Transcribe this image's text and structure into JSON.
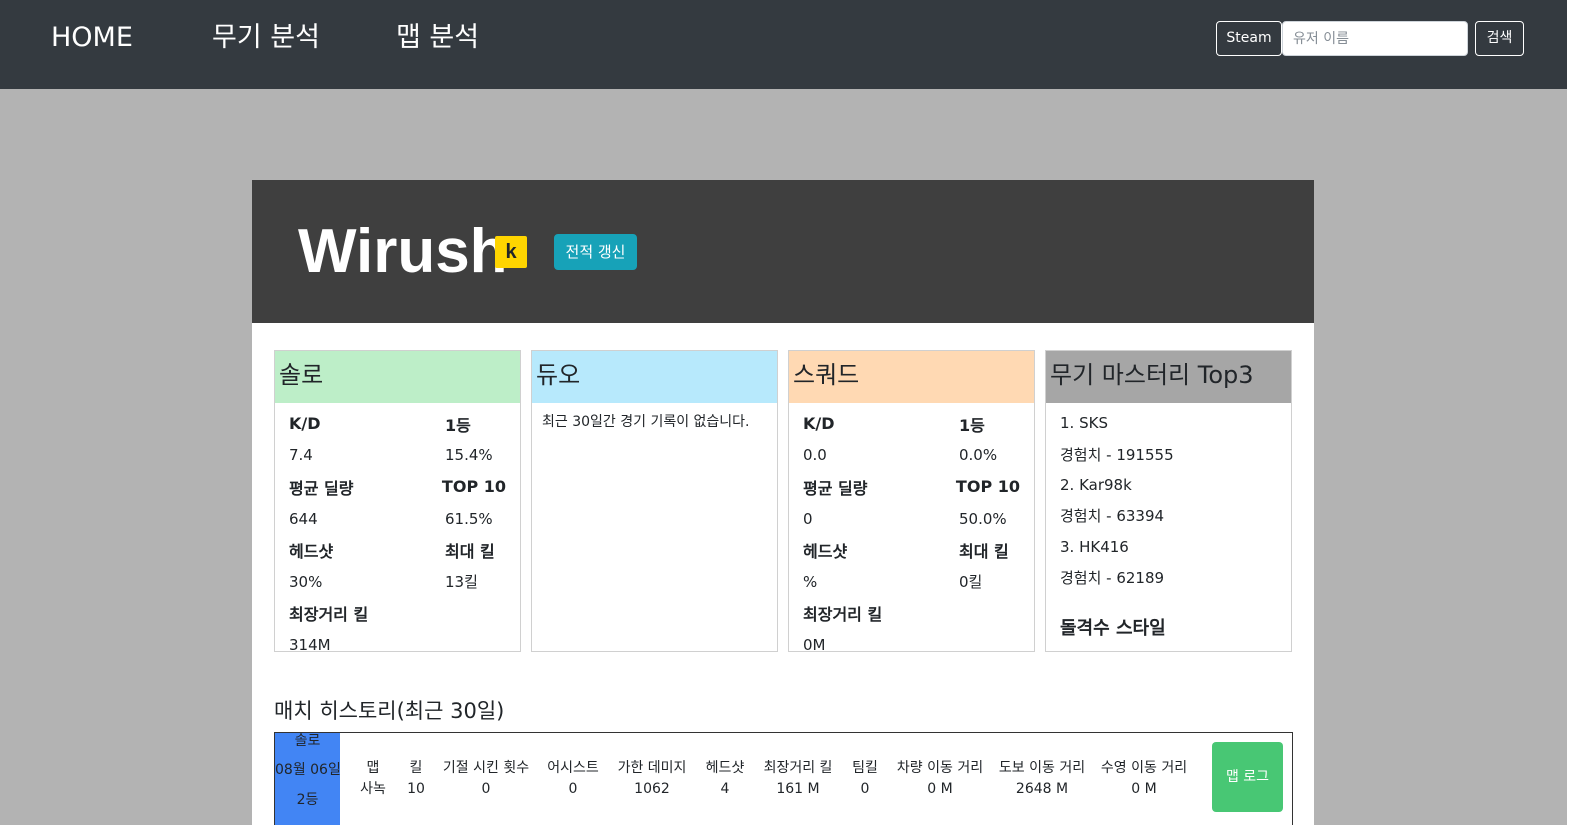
{
  "nav": {
    "home": "HOME",
    "weapon_analysis": "무기 분석",
    "map_analysis": "맵 분석",
    "platform": "Steam",
    "search_placeholder": "유저 이름",
    "search_button": "검색"
  },
  "profile": {
    "name": "Wirush",
    "badge": "k",
    "refresh_button": "전적 갱신"
  },
  "cards": {
    "solo": {
      "title": "솔로",
      "rows": [
        [
          "K/D",
          "1등"
        ],
        [
          "7.4",
          "15.4%"
        ],
        [
          "평균 딜량",
          "TOP 10"
        ],
        [
          "644",
          "61.5%"
        ],
        [
          "헤드샷",
          "최대 킬"
        ],
        [
          "30%",
          "13킬"
        ],
        [
          "최장거리 킬",
          ""
        ],
        [
          "314M",
          ""
        ]
      ]
    },
    "duo": {
      "title": "듀오",
      "empty": "최근 30일간 경기 기록이 없습니다."
    },
    "squad": {
      "title": "스쿼드",
      "rows": [
        [
          "K/D",
          "1등"
        ],
        [
          "0.0",
          "0.0%"
        ],
        [
          "평균 딜량",
          "TOP 10"
        ],
        [
          "0",
          "50.0%"
        ],
        [
          "헤드샷",
          "최대 킬"
        ],
        [
          "%",
          "0킬"
        ],
        [
          "최장거리 킬",
          ""
        ],
        [
          "0M",
          ""
        ]
      ]
    },
    "weapon": {
      "title": "무기 마스터리 Top3",
      "lines": [
        "1. SKS",
        "경험치 - 191555",
        "2. Kar98k",
        "경험치 - 63394",
        "3. HK416",
        "경험치 - 62189"
      ],
      "style": "돌격수 스타일"
    }
  },
  "history": {
    "title": "매치 히스토리(최근 30일)",
    "matches": [
      {
        "mode": "솔로",
        "date": "08월 06일",
        "rank": "2등",
        "columns": [
          [
            "맵",
            "사녹"
          ],
          [
            "킬",
            "10"
          ],
          [
            "기절 시킨 횟수",
            "0"
          ],
          [
            "어시스트",
            "0"
          ],
          [
            "가한 데미지",
            "1062"
          ],
          [
            "헤드샷",
            "4"
          ],
          [
            "최장거리 킬",
            "161 M"
          ],
          [
            "팀킬",
            "0"
          ],
          [
            "차량 이동 거리",
            "0 M"
          ],
          [
            "도보 이동 거리",
            "2648 M"
          ],
          [
            "수영 이동 거리",
            "0 M"
          ]
        ],
        "log_button": "맵 로그"
      }
    ]
  },
  "colors": {
    "navbar": "#343a40",
    "header": "#3f3f3f",
    "solo": "#bdeec8",
    "duo": "#b7e9fc",
    "squad": "#ffd9b3",
    "weapon": "#a6a6a6",
    "badge": "#ffd500",
    "refresh": "#17a2b8",
    "match_type": "#4285f4",
    "map_log": "#48c774"
  }
}
